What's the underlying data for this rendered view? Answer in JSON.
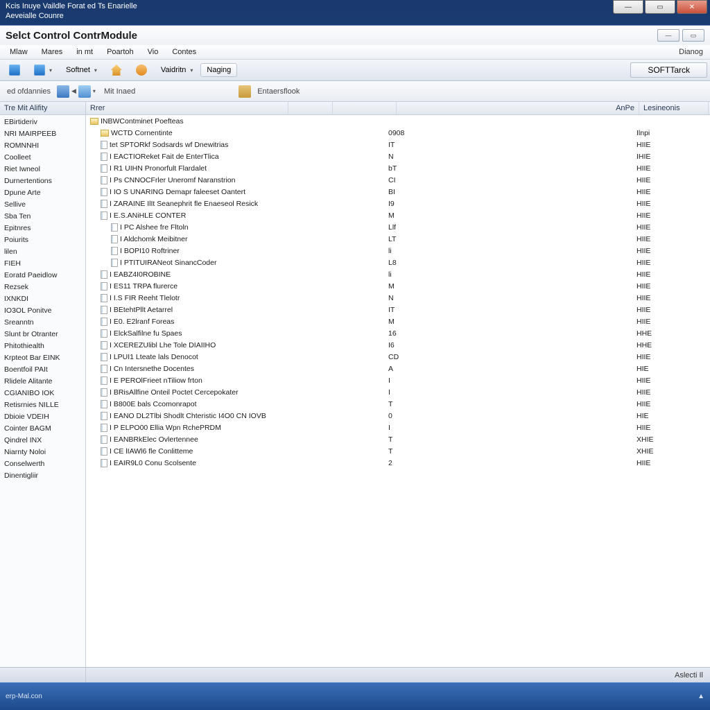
{
  "parent_title_line1": "Kcis Inuye Vaildle Forat ed Ts Enarielle",
  "parent_title_line2": "Aeveialle Counre",
  "app_title": "Selct Control ContrModule",
  "menu": {
    "items": [
      "Mlaw",
      "Mares",
      "in mt",
      "Poartoh",
      "Vio",
      "Contes"
    ],
    "right": "Dianog"
  },
  "toolbar": {
    "softnet": "Softnet",
    "validator": "Vaidritn",
    "naging": "Naging",
    "softtrack": "SOFTTarck"
  },
  "toolbar2": {
    "oldannies": "ed ofdannies",
    "mitinaed": "Mit Inaed",
    "entersflook": "Entaersflook"
  },
  "sidebar": {
    "header": "Tre Mit Alifity",
    "items": [
      "EBirtideriv",
      "NRI MAIRPEEB",
      "ROMNNHI",
      "Coolleet",
      "Riet Iwneol",
      "Durnertentions",
      "Dpune Arte",
      "Sellive",
      "Sba Ten",
      "Epitnres",
      "Poiurits",
      "lilen",
      "FIEH",
      "Eoratd Paeidlow",
      "Rezsek",
      "IXNKDI",
      "IO3OL Ponitve",
      "Sreanntn",
      "Slunt br Otranter",
      "Phitothiealth",
      "Krpteot Bar EINK",
      "Boentfoil PAIt",
      "Rlidele Alitante",
      "CGIANIBO IOK",
      "Retisrnies NILLE",
      "Dbioie VDEIH",
      "Cointer BAGM",
      "Qindrel INX",
      "Niarnty Noloi",
      "Conselwerth",
      "Dinentigliir"
    ]
  },
  "columns": {
    "c1": "Rrer",
    "c4": "AnPe",
    "c5": "Lesineonis"
  },
  "rows": [
    {
      "indent": 0,
      "type": "folder",
      "name": "INBWContminet Poefteas",
      "c2": "",
      "c3": ""
    },
    {
      "indent": 1,
      "type": "folder",
      "name": "WCTD Cornentinte",
      "c2": "0908",
      "c3": "Ilnpi"
    },
    {
      "indent": 1,
      "type": "item",
      "name": "tet SPTORkf Sodsards wf Dnewitrias",
      "c2": "IT",
      "c3": "HIIE"
    },
    {
      "indent": 1,
      "type": "item",
      "name": "I EACTIOReket Fait de EnterTlica",
      "c2": "N",
      "c3": "IHIE"
    },
    {
      "indent": 1,
      "type": "item",
      "name": "I R1 UIHN Pronorfult Flardalet",
      "c2": "bT",
      "c3": "HIIE"
    },
    {
      "indent": 1,
      "type": "item",
      "name": "I Ps CNNOCFrler Uneromf Naranstrion",
      "c2": "CI",
      "c3": "HIIE"
    },
    {
      "indent": 1,
      "type": "item",
      "name": "I IO S UNARING Demapr faleeset Oantert",
      "c2": "BI",
      "c3": "HIIE"
    },
    {
      "indent": 1,
      "type": "item",
      "name": "I ZARAINE IlIt Seanephrit fle Enaeseol Resick",
      "c2": "I9",
      "c3": "HIIE"
    },
    {
      "indent": 1,
      "type": "item",
      "name": "I E.S.ANiHLE CONTER",
      "c2": "M",
      "c3": "HIIE"
    },
    {
      "indent": 2,
      "type": "item",
      "name": "I PC Alshee fre Fltoln",
      "c2": "Llf",
      "c3": "HIIE"
    },
    {
      "indent": 2,
      "type": "item",
      "name": "I Aldchomk Meibitner",
      "c2": "LT",
      "c3": "HIIE"
    },
    {
      "indent": 2,
      "type": "item",
      "name": "I BOPI10 Roftriner",
      "c2": "li",
      "c3": "HIIE"
    },
    {
      "indent": 2,
      "type": "item",
      "name": "I PTITUIRANeot SinancCoder",
      "c2": "L8",
      "c3": "HIIE"
    },
    {
      "indent": 1,
      "type": "item",
      "name": "I EABZ4I0ROBINE",
      "c2": "li",
      "c3": "HIIE"
    },
    {
      "indent": 1,
      "type": "item",
      "name": "I ES11 TRPA flurerce",
      "c2": "M",
      "c3": "HIIE"
    },
    {
      "indent": 1,
      "type": "item",
      "name": "I I.S FIR Reeht Tlelotr",
      "c2": "N",
      "c3": "HIIE"
    },
    {
      "indent": 1,
      "type": "item",
      "name": "I BEtehtPllt Aetarrel",
      "c2": "IT",
      "c3": "HIIE"
    },
    {
      "indent": 1,
      "type": "item",
      "name": "I E0. E2lranf Foreas",
      "c2": "M",
      "c3": "HIIE"
    },
    {
      "indent": 1,
      "type": "item",
      "name": "I ElckSalfilne fu Spaes",
      "c2": "16",
      "c3": "HHE"
    },
    {
      "indent": 1,
      "type": "item",
      "name": "I XCEREZUlibl Lhe Tole DIAIIHO",
      "c2": "I6",
      "c3": "HHE"
    },
    {
      "indent": 1,
      "type": "item",
      "name": "I LPUI1 Lteate lals Denocot",
      "c2": "CD",
      "c3": "HIIE"
    },
    {
      "indent": 1,
      "type": "item",
      "name": "I Cn Intersnethe Docentes",
      "c2": "A",
      "c3": "HIE"
    },
    {
      "indent": 1,
      "type": "item",
      "name": "I E PEROlFrieet nTiliow frton",
      "c2": "I",
      "c3": "HIIE"
    },
    {
      "indent": 1,
      "type": "item",
      "name": "I BRisAllfine Onteil Poctet Cercepokater",
      "c2": "I",
      "c3": "HIIE"
    },
    {
      "indent": 1,
      "type": "item",
      "name": "I B800E bals Ccomonrapot",
      "c2": "T",
      "c3": "HIIE"
    },
    {
      "indent": 1,
      "type": "item",
      "name": "I EANO DL2Tlbi Shodlt Chteristic I4O0 CN IOVB",
      "c2": "0",
      "c3": "HIE"
    },
    {
      "indent": 1,
      "type": "item",
      "name": "I P ELPO00 Ellia Wpn RchePRDM",
      "c2": "I",
      "c3": "HIIE"
    },
    {
      "indent": 1,
      "type": "item",
      "name": "I EANBRkElec Ovlertennee",
      "c2": "T",
      "c3": "XHIE"
    },
    {
      "indent": 1,
      "type": "item",
      "name": "I CE lIAWl6 fle Conlitteme",
      "c2": "T",
      "c3": "XHIE"
    },
    {
      "indent": 1,
      "type": "item",
      "name": "I EAIR9L0 Conu Scolsente",
      "c2": "2",
      "c3": "HIIE"
    }
  ],
  "statusbar": {
    "right": "Aslecti Il"
  },
  "taskbar": {
    "left": "erp-Mal.con"
  }
}
